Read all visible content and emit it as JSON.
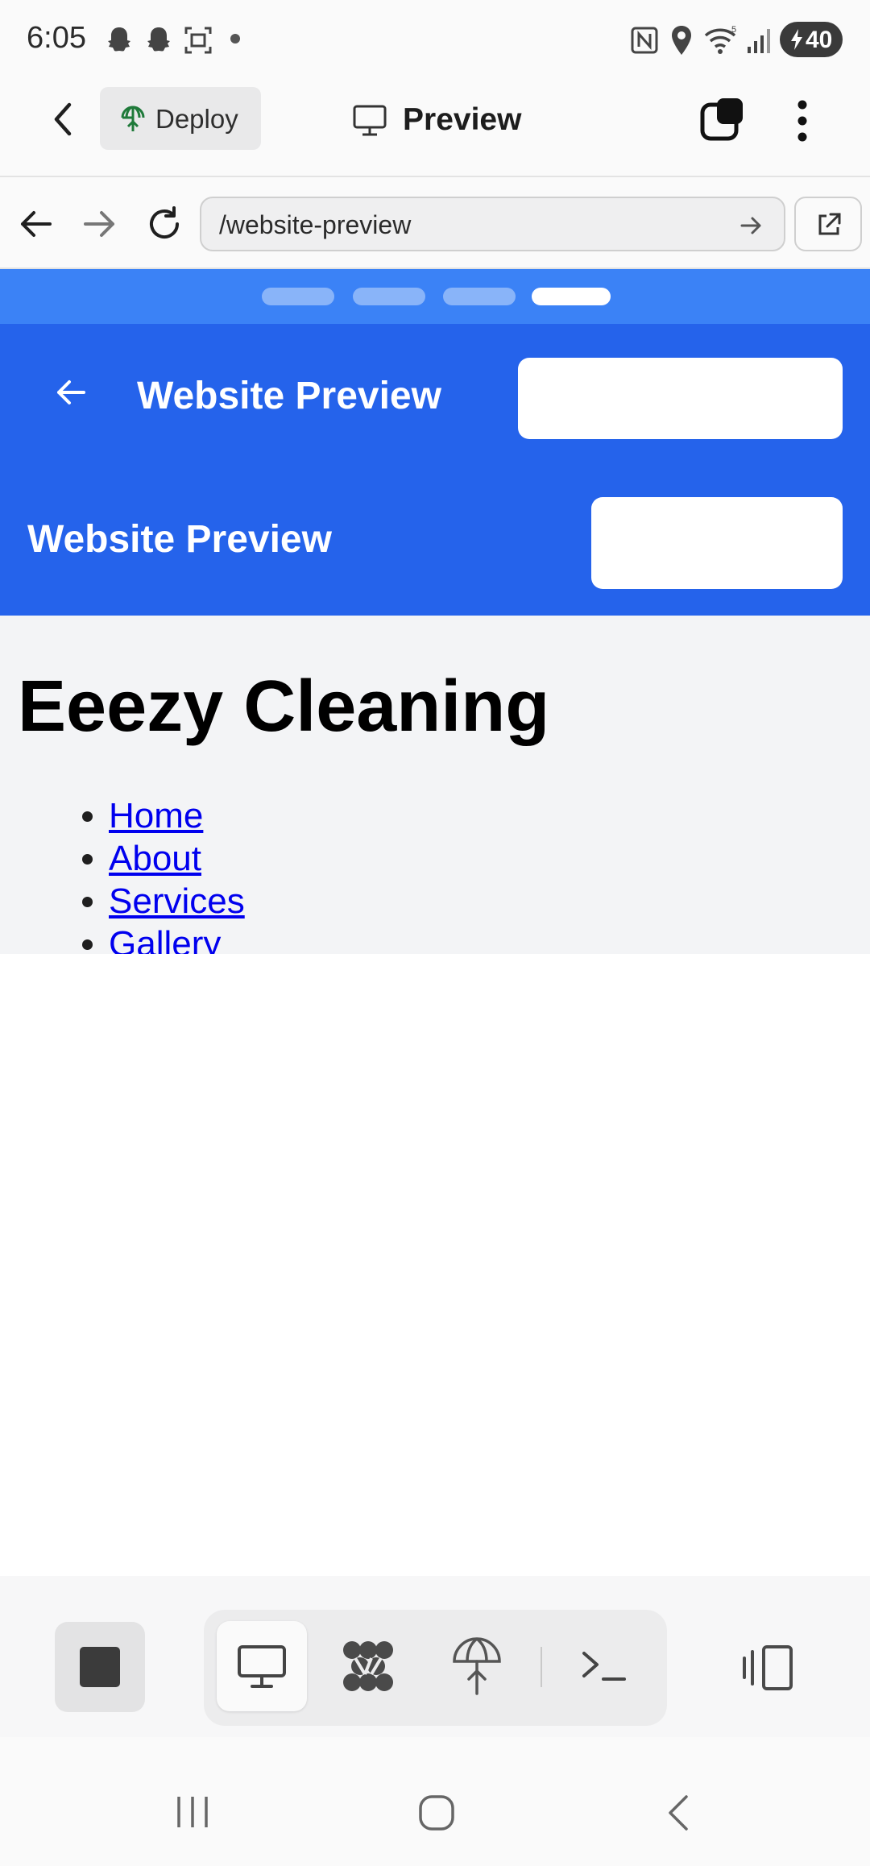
{
  "status_bar": {
    "time": "6:05",
    "battery": "40",
    "icons": [
      "snapchat-icon",
      "snapchat-icon",
      "screenshot-icon",
      "dot-icon",
      "nfc-icon",
      "location-icon",
      "wifi-icon",
      "signal-icon",
      "battery-icon"
    ]
  },
  "header": {
    "back_icon": "chevron-left-icon",
    "deploy_label": "Deploy",
    "title": "Preview",
    "title_icon": "monitor-icon",
    "tabs_icon": "tabs-icon",
    "menu_icon": "more-vertical-icon"
  },
  "browser": {
    "url": "/website-preview",
    "back_icon": "arrow-left-icon",
    "forward_icon": "arrow-right-icon",
    "reload_icon": "reload-icon",
    "go_icon": "arrow-right-icon",
    "external_icon": "external-link-icon"
  },
  "preview": {
    "progress_steps": 4,
    "active_step": 4,
    "header_title": "Website Preview",
    "sub_title": "Website Preview",
    "site_title": "Eeezy Cleaning",
    "nav_links": [
      "Home",
      "About",
      "Services",
      "Gallery"
    ],
    "colors": {
      "header_blue": "#2563eb",
      "strip_blue": "#3b82f6",
      "link": "#0000ee"
    }
  },
  "toolbar": {
    "stop_icon": "stop-icon",
    "tools": [
      "monitor-icon",
      "packager-icon",
      "deploy-icon",
      "terminal-icon"
    ],
    "active_tool": "monitor-icon",
    "side_icon": "split-view-icon"
  },
  "android_nav": [
    "recents-icon",
    "home-icon",
    "back-icon"
  ]
}
